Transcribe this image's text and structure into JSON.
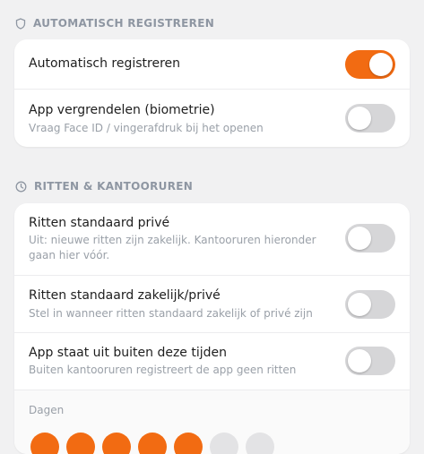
{
  "sections": {
    "auto": {
      "header": "AUTOMATISCH REGISTREREN",
      "rows": [
        {
          "title": "Automatisch registreren",
          "toggle_on": true
        },
        {
          "title": "App vergrendelen (biometrie)",
          "subtitle": "Vraag Face ID / vingerafdruk bij het openen",
          "toggle_on": false
        }
      ]
    },
    "trips": {
      "header": "RITTEN & KANTOORUREN",
      "rows": [
        {
          "title": "Ritten standaard privé",
          "subtitle": "Uit: nieuwe ritten zijn zakelijk. Kantooruren hieronder gaan hier vóór.",
          "toggle_on": false
        },
        {
          "title": "Ritten standaard zakelijk/privé",
          "subtitle": "Stel in wanneer ritten standaard zakelijk of privé zijn",
          "toggle_on": false
        },
        {
          "title": "App staat uit buiten deze tijden",
          "subtitle": "Buiten kantooruren registreert de app geen ritten",
          "toggle_on": false
        }
      ],
      "days_label": "Dagen",
      "days_selected": [
        true,
        true,
        true,
        true,
        true,
        false,
        false
      ]
    }
  },
  "colors": {
    "accent": "#f26b12",
    "toggle_off": "#d6d6d8",
    "header": "#8e96a2"
  }
}
